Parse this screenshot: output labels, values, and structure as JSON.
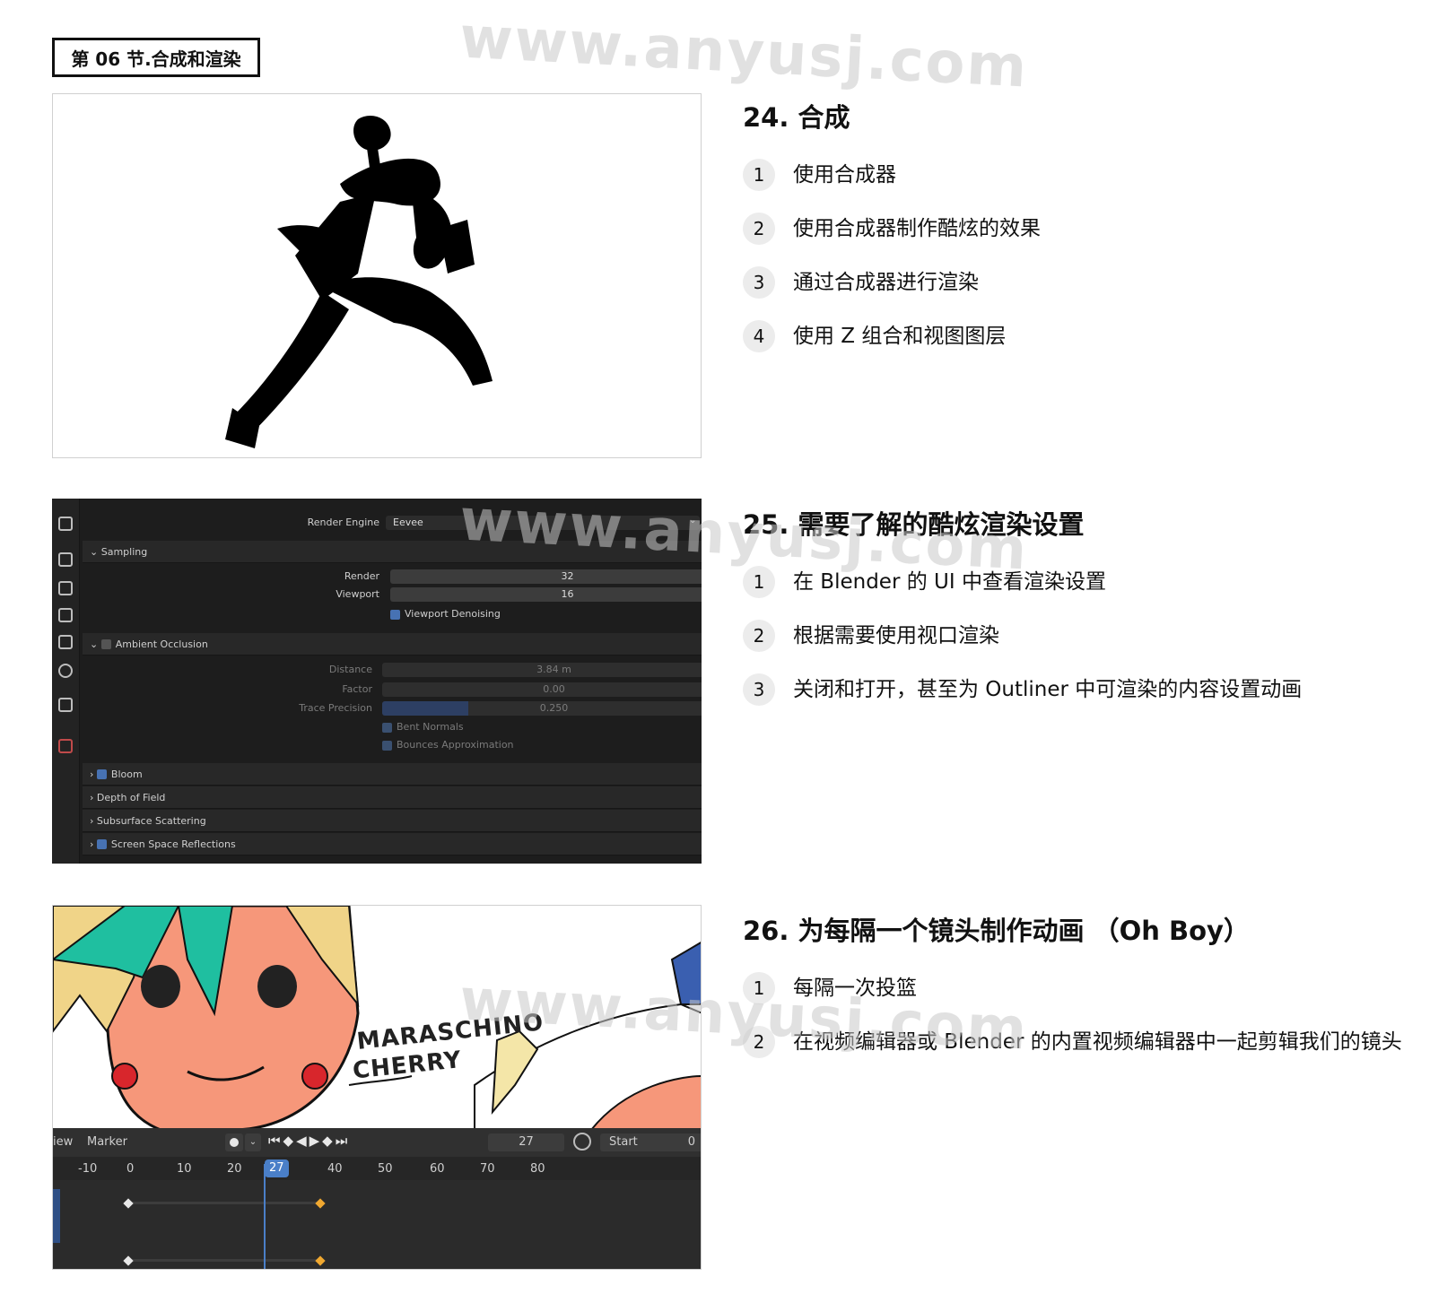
{
  "section_tag": "第 06 节.合成和渲染",
  "watermark": "www.anyusj.com",
  "topics": [
    {
      "title": "24. 合成",
      "items": [
        {
          "num": "1",
          "text": "使用合成器"
        },
        {
          "num": "2",
          "text": "使用合成器制作酷炫的效果"
        },
        {
          "num": "3",
          "text": "通过合成器进行渲染"
        },
        {
          "num": "4",
          "text": "使用 Z 组合和视图图层"
        }
      ]
    },
    {
      "title": "25. 需要了解的酷炫渲染设置",
      "items": [
        {
          "num": "1",
          "text": "在 Blender 的 UI 中查看渲染设置"
        },
        {
          "num": "2",
          "text": "根据需要使用视口渲染"
        },
        {
          "num": "3",
          "text": "关闭和打开，甚至为 Outliner 中可渲染的内容设置动画"
        }
      ]
    },
    {
      "title": "26. 为每隔一个镜头制作动画 （Oh Boy）",
      "items": [
        {
          "num": "1",
          "text": "每隔一次投篮"
        },
        {
          "num": "2",
          "text": "在视频编辑器或 Blender 的内置视频编辑器中一起剪辑我们的镜头"
        }
      ]
    }
  ],
  "render_panel": {
    "render_engine_label": "Render Engine",
    "render_engine_value": "Eevee",
    "sampling": "Sampling",
    "render_label": "Render",
    "render_value": "32",
    "viewport_label": "Viewport",
    "viewport_value": "16",
    "viewport_denoising": "Viewport Denoising",
    "ambient_occlusion": "Ambient Occlusion",
    "distance_label": "Distance",
    "distance_value": "3.84 m",
    "factor_label": "Factor",
    "factor_value": "0.00",
    "trace_precision_label": "Trace Precision",
    "trace_precision_value": "0.250",
    "trace_precision_fill": 0.25,
    "bent_normals": "Bent Normals",
    "bounces_approximation": "Bounces Approximation",
    "bloom": "Bloom",
    "depth_of_field": "Depth of Field",
    "subsurface_scattering": "Subsurface Scattering",
    "screen_space_reflections": "Screen Space Reflections"
  },
  "cartoon": {
    "text_line1": "MARASCHINO",
    "text_line2": "CHERRY"
  },
  "timeline": {
    "view": "iew",
    "marker": "Marker",
    "current_frame": "27",
    "start_label": "Start",
    "start_value": "0",
    "ticks": [
      "-10",
      "0",
      "10",
      "20",
      "27",
      "40",
      "50",
      "60",
      "70",
      "80"
    ]
  }
}
